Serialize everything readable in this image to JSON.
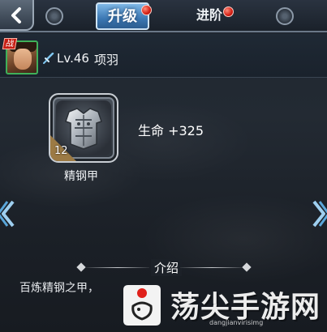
{
  "tabs": [
    {
      "label": "升级",
      "active": true,
      "badge": true
    },
    {
      "label": "进阶",
      "active": false,
      "badge": true
    }
  ],
  "hero": {
    "badge": "战",
    "level": "Lv.46",
    "name": "项羽"
  },
  "equipment": {
    "name": "精钢甲",
    "level": "12",
    "icon": "armor-icon",
    "stat": "生命 +325"
  },
  "intro": {
    "title": "介绍",
    "description": "百炼精钢之甲，"
  },
  "watermark": {
    "logo_text": "荡尖手游网",
    "url": "dangjianvirisimg"
  },
  "colors": {
    "active_tab": "#3c78b4",
    "badge_red": "#d41f14",
    "avatar_border": "#3fb05a",
    "background": "#1e2630"
  }
}
